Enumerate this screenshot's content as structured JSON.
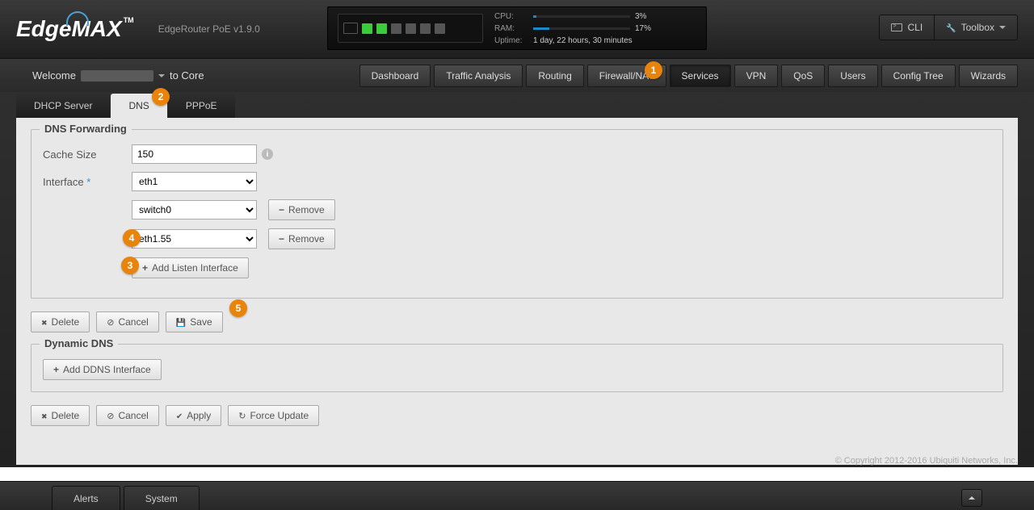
{
  "header": {
    "logo": "EdgeMAX",
    "tm": "TM",
    "model": "EdgeRouter PoE v1.9.0",
    "cli_label": "CLI",
    "toolbox_label": "Toolbox"
  },
  "status": {
    "cpu_label": "CPU:",
    "cpu_pct": "3%",
    "cpu_fill": 3,
    "ram_label": "RAM:",
    "ram_pct": "17%",
    "ram_fill": 17,
    "uptime_label": "Uptime:",
    "uptime_value": "1 day, 22 hours, 30 minutes"
  },
  "welcome": {
    "prefix": "Welcome",
    "suffix": "to Core"
  },
  "nav": {
    "items": [
      "Dashboard",
      "Traffic Analysis",
      "Routing",
      "Firewall/NAT",
      "Services",
      "VPN",
      "QoS",
      "Users",
      "Config Tree",
      "Wizards"
    ],
    "active_index": 4
  },
  "subtabs": {
    "items": [
      "DHCP Server",
      "DNS",
      "PPPoE"
    ],
    "active_index": 1
  },
  "dns_forwarding": {
    "legend": "DNS Forwarding",
    "cache_label": "Cache Size",
    "cache_value": "150",
    "interface_label": "Interface",
    "interfaces": [
      "eth1",
      "switch0",
      "eth1.55"
    ],
    "remove_label": "Remove",
    "add_listen_label": "Add Listen Interface"
  },
  "actions1": {
    "delete": "Delete",
    "cancel": "Cancel",
    "save": "Save"
  },
  "ddns": {
    "legend": "Dynamic DNS",
    "add_label": "Add DDNS Interface"
  },
  "actions2": {
    "delete": "Delete",
    "cancel": "Cancel",
    "apply": "Apply",
    "force": "Force Update"
  },
  "footer": "© Copyright 2012-2016 Ubiquiti Networks, Inc.",
  "bottom": {
    "alerts": "Alerts",
    "system": "System"
  },
  "annotations": [
    "1",
    "2",
    "3",
    "4",
    "5"
  ]
}
